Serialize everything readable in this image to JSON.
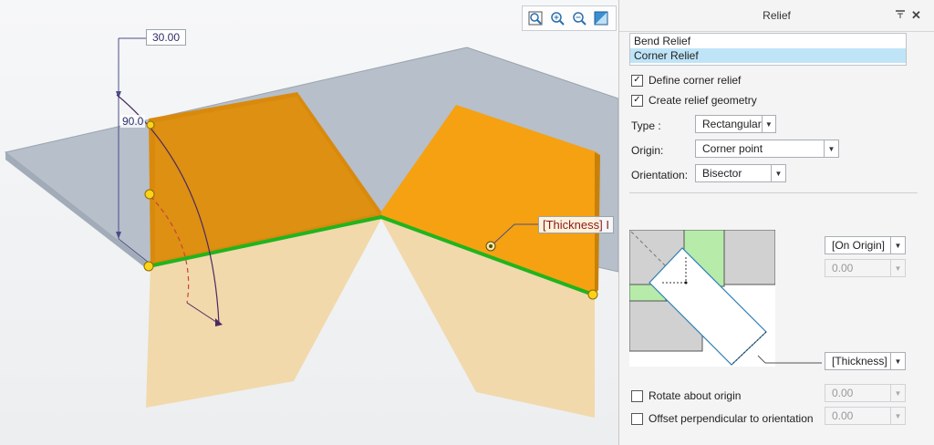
{
  "viewport": {
    "dims": {
      "height_value": "30.00",
      "angle_value": "90.0"
    },
    "thickness_label": "[Thickness] I",
    "toolbar": [
      {
        "name": "refit-icon"
      },
      {
        "name": "zoom-in-icon"
      },
      {
        "name": "zoom-out-icon"
      },
      {
        "name": "display-style-icon"
      }
    ]
  },
  "panel": {
    "title": "Relief",
    "list": {
      "items": [
        "Bend Relief",
        "Corner Relief"
      ],
      "selected": "Corner Relief"
    },
    "define_corner_relief": {
      "label": "Define corner relief",
      "checked": true
    },
    "create_relief_geometry": {
      "label": "Create relief geometry",
      "checked": true
    },
    "type": {
      "label": "Type :",
      "value": "Rectangular"
    },
    "origin": {
      "label": "Origin:",
      "value": "Corner point"
    },
    "orientation": {
      "label": "Orientation:",
      "value": "Bisector"
    },
    "diagram_params": {
      "on_origin": "[On Origin]",
      "origin_offset": "0.00",
      "thickness": "[Thickness]"
    },
    "rotate_about_origin": {
      "label": "Rotate about origin",
      "checked": false,
      "value": "0.00"
    },
    "offset_perpendicular": {
      "label": "Offset perpendicular to orientation",
      "checked": false,
      "value": "0.00"
    }
  },
  "colors": {
    "flange": "#f5a111",
    "flange_dark": "#d98a0c",
    "ghost": "#f1d9ab",
    "base_plate": "#b6bfca",
    "edge": "#21b41e",
    "handle": "#ffd21a"
  }
}
